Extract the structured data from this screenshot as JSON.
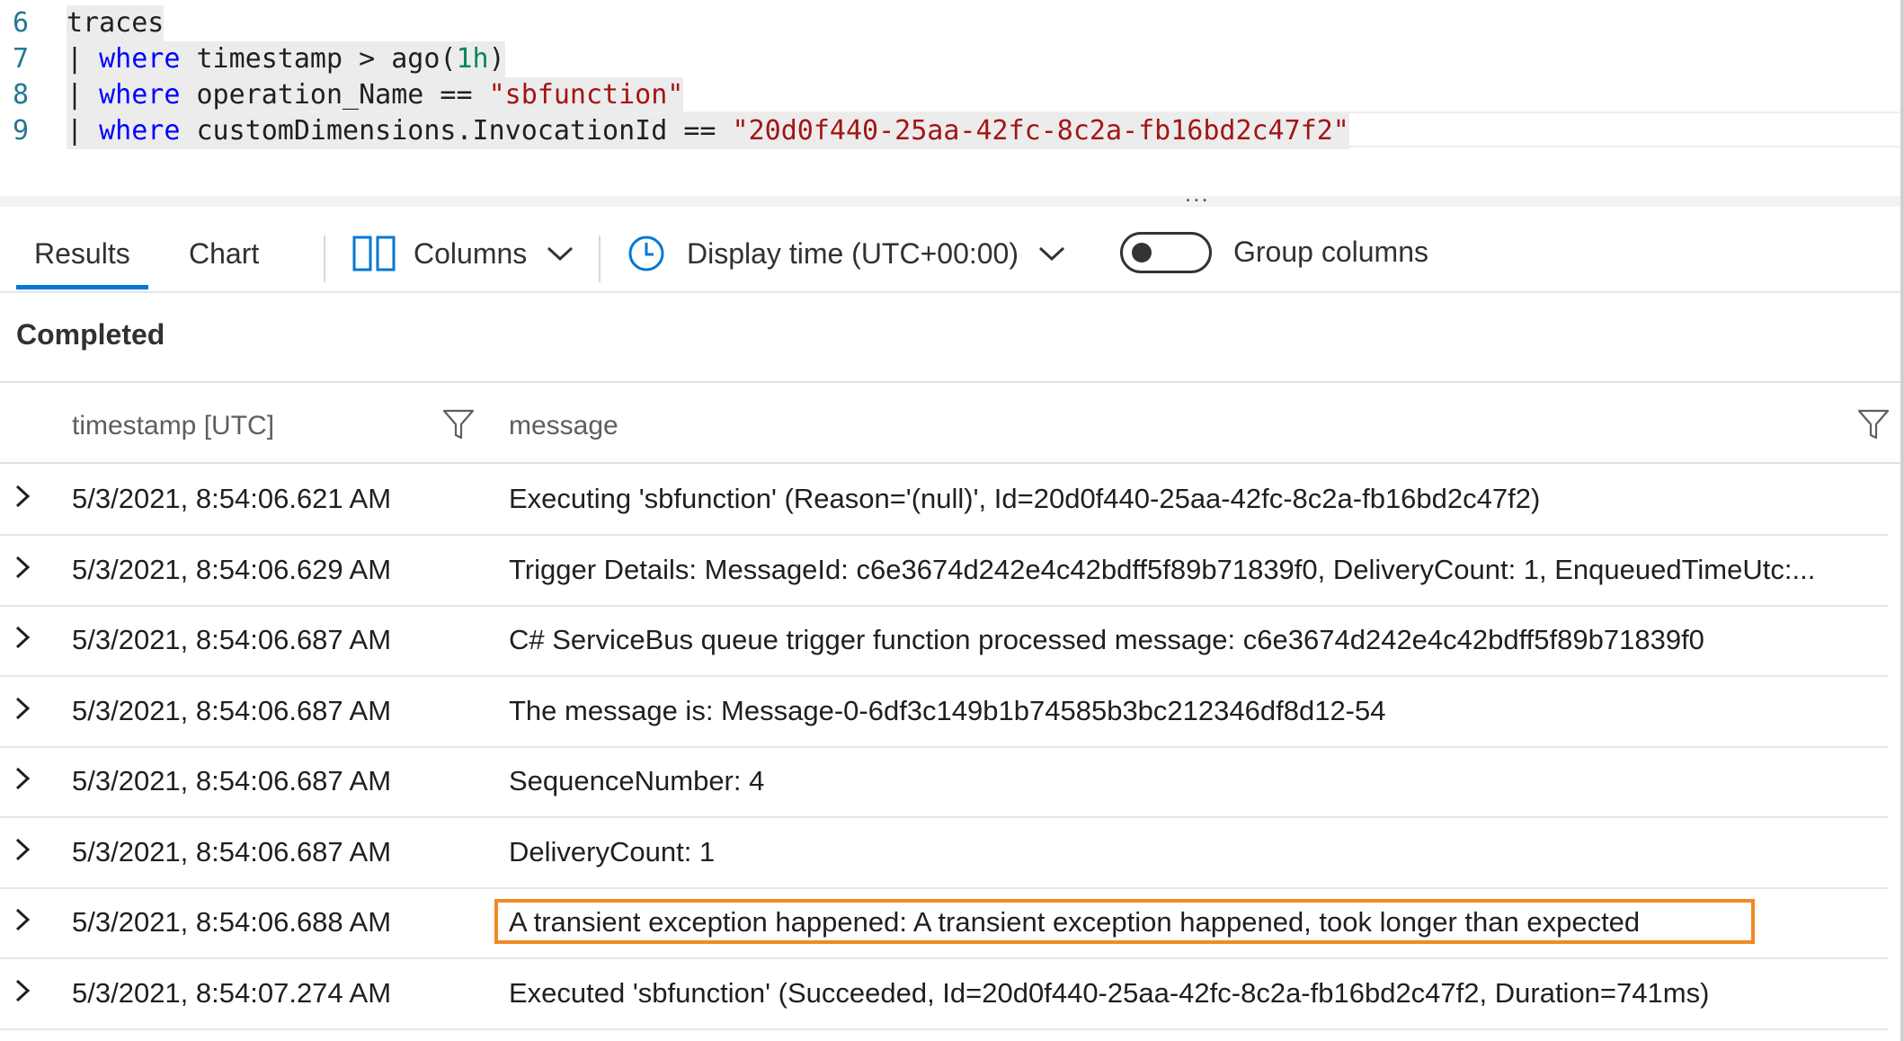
{
  "editor": {
    "lines": [
      {
        "no": "6",
        "parts": [
          {
            "t": "traces",
            "c": "plain"
          }
        ]
      },
      {
        "no": "7",
        "parts": [
          {
            "t": "| ",
            "c": "pipe"
          },
          {
            "t": "where",
            "c": "kw"
          },
          {
            "t": " timestamp > ago(",
            "c": "plain"
          },
          {
            "t": "1h",
            "c": "num"
          },
          {
            "t": ")",
            "c": "plain"
          }
        ]
      },
      {
        "no": "8",
        "parts": [
          {
            "t": "| ",
            "c": "pipe"
          },
          {
            "t": "where",
            "c": "kw"
          },
          {
            "t": " operation_Name == ",
            "c": "plain"
          },
          {
            "t": "\"sbfunction\"",
            "c": "str"
          }
        ]
      },
      {
        "no": "9",
        "parts": [
          {
            "t": "| ",
            "c": "pipe"
          },
          {
            "t": "where",
            "c": "kw"
          },
          {
            "t": " customDimensions.InvocationId == ",
            "c": "plain"
          },
          {
            "t": "\"20d0f440-25aa-42fc-8c2a-fb16bd2c47f2\"",
            "c": "str"
          }
        ]
      }
    ],
    "splitter_dots": "..."
  },
  "toolbar": {
    "tab_results": "Results",
    "tab_chart": "Chart",
    "columns_label": "Columns",
    "display_time_label": "Display time (UTC+00:00)",
    "group_columns_label": "Group columns",
    "group_columns_on": false
  },
  "status": "Completed",
  "table": {
    "headers": {
      "timestamp": "timestamp [UTC]",
      "message": "message"
    },
    "rows": [
      {
        "timestamp": "5/3/2021, 8:54:06.621 AM",
        "message": "Executing 'sbfunction' (Reason='(null)', Id=20d0f440-25aa-42fc-8c2a-fb16bd2c47f2)"
      },
      {
        "timestamp": "5/3/2021, 8:54:06.629 AM",
        "message": "Trigger Details: MessageId: c6e3674d242e4c42bdff5f89b71839f0, DeliveryCount: 1, EnqueuedTimeUtc:..."
      },
      {
        "timestamp": "5/3/2021, 8:54:06.687 AM",
        "message": "C# ServiceBus queue trigger function processed message: c6e3674d242e4c42bdff5f89b71839f0"
      },
      {
        "timestamp": "5/3/2021, 8:54:06.687 AM",
        "message": "The message is: Message-0-6df3c149b1b74585b3bc212346df8d12-54"
      },
      {
        "timestamp": "5/3/2021, 8:54:06.687 AM",
        "message": "SequenceNumber: 4"
      },
      {
        "timestamp": "5/3/2021, 8:54:06.687 AM",
        "message": "DeliveryCount: 1"
      },
      {
        "timestamp": "5/3/2021, 8:54:06.688 AM",
        "message": "A transient exception happened: A transient exception happened, took longer than expected"
      },
      {
        "timestamp": "5/3/2021, 8:54:07.274 AM",
        "message": "Executed 'sbfunction' (Succeeded, Id=20d0f440-25aa-42fc-8c2a-fb16bd2c47f2, Duration=741ms)"
      }
    ]
  },
  "colors": {
    "accent": "#0078d4",
    "highlight_border": "#f08a24",
    "keyword": "#0000ff",
    "string": "#a31515",
    "number": "#098658",
    "line_number": "#237893"
  },
  "icons": [
    "columns-icon",
    "chevron-down-icon",
    "clock-icon",
    "filter-icon",
    "expand-chevron-icon"
  ]
}
